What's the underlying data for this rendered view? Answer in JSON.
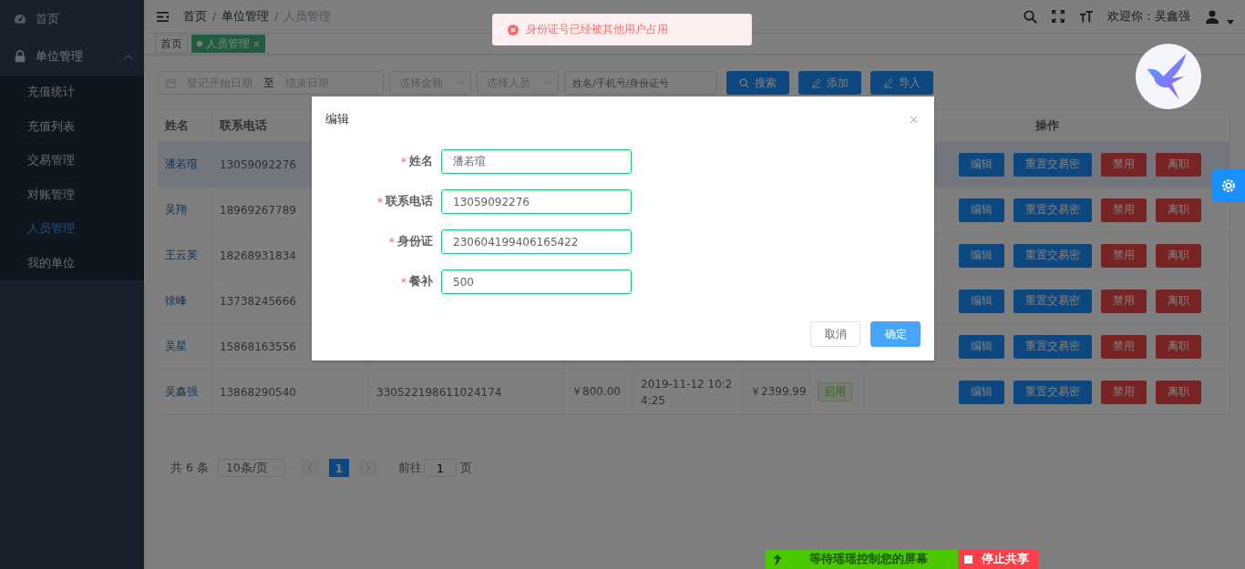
{
  "sidebar": {
    "items": [
      {
        "label": "首页",
        "kind": "dashboard"
      },
      {
        "label": "单位管理",
        "kind": "lock",
        "expanded": true,
        "children": [
          {
            "label": "充值统计",
            "selected": false
          },
          {
            "label": "充值列表",
            "selected": false
          },
          {
            "label": "交易管理",
            "selected": false
          },
          {
            "label": "对账管理",
            "selected": false
          },
          {
            "label": "人员管理",
            "selected": true
          },
          {
            "label": "我的单位",
            "selected": false
          }
        ]
      }
    ]
  },
  "header": {
    "breadcrumb": [
      "首页",
      "单位管理",
      "人员管理"
    ],
    "breadcrumb_separators": [
      "/",
      "/"
    ],
    "welcome": "欢迎你：吴鑫强"
  },
  "tags": [
    {
      "label": "首页",
      "selected": false
    },
    {
      "label": "人员管理",
      "selected": true
    }
  ],
  "filters": {
    "date_start": "登记开始日期",
    "separator": "至",
    "date_end": "结束日期",
    "amount": "选择金额",
    "status": "选择人员",
    "search": {
      "placeholder": "姓名/手机号/身份证号"
    },
    "buttons": [
      {
        "label": "搜索",
        "kind": "search"
      },
      {
        "label": "添加",
        "kind": "edit"
      },
      {
        "label": "导入",
        "kind": "edit"
      }
    ]
  },
  "table": {
    "columns": [
      "姓名",
      "联系电话",
      "操作"
    ],
    "rows": [
      {
        "name": "潘若瑄",
        "phone": "13059092276",
        "selected": true,
        "actions": [
          {
            "label": "编辑",
            "kind": "primary"
          },
          {
            "label": "重置交易密",
            "kind": "primary"
          },
          {
            "label": "禁用",
            "kind": "danger"
          },
          {
            "label": "离职",
            "kind": "danger"
          }
        ]
      },
      {
        "name": "吴翔",
        "phone": "18969267789",
        "selected": false,
        "actions": [
          {
            "label": "编辑",
            "kind": "primary"
          },
          {
            "label": "重置交易密",
            "kind": "primary"
          },
          {
            "label": "禁用",
            "kind": "danger"
          },
          {
            "label": "离职",
            "kind": "danger"
          }
        ]
      },
      {
        "name": "王云英",
        "phone": "18268931834",
        "selected": false,
        "actions": [
          {
            "label": "编辑",
            "kind": "primary"
          },
          {
            "label": "重置交易密",
            "kind": "primary"
          },
          {
            "label": "禁用",
            "kind": "danger"
          },
          {
            "label": "离职",
            "kind": "danger"
          }
        ]
      },
      {
        "name": "徐峰",
        "phone": "13738245666",
        "selected": false,
        "actions": [
          {
            "label": "编辑",
            "kind": "primary"
          },
          {
            "label": "重置交易密",
            "kind": "primary"
          },
          {
            "label": "禁用",
            "kind": "danger"
          },
          {
            "label": "离职",
            "kind": "danger"
          }
        ]
      },
      {
        "name": "吴星",
        "phone": "15868163556",
        "selected": false,
        "actions": [
          {
            "label": "编辑",
            "kind": "primary"
          },
          {
            "label": "重置交易密",
            "kind": "primary"
          },
          {
            "label": "禁用",
            "kind": "danger"
          },
          {
            "label": "离职",
            "kind": "danger"
          }
        ]
      },
      {
        "name": "吴鑫强",
        "phone": "13868290540",
        "id_card": "330522198611024174",
        "meal": "￥800.00",
        "time": "2019-11-12 10:24:25",
        "balance": "￥2399.99",
        "status": "启用",
        "selected": false,
        "actions": [
          {
            "label": "编辑",
            "kind": "primary"
          },
          {
            "label": "重置交易密",
            "kind": "primary"
          },
          {
            "label": "禁用",
            "kind": "danger"
          },
          {
            "label": "离职",
            "kind": "danger"
          }
        ]
      }
    ]
  },
  "pagination": {
    "total": "共 6 条",
    "page_size": "10条/页",
    "pages": [
      {
        "label": "1",
        "selected": true
      }
    ],
    "goto_label": "前往",
    "goto_value": "1",
    "goto_suffix": "页"
  },
  "dialog": {
    "title": "编辑",
    "required_mark": "*",
    "fields": [
      {
        "label": "姓名",
        "value": "潘若瑄",
        "required": true
      },
      {
        "label": "联系电话",
        "value": "13059092276",
        "required": true
      },
      {
        "label": "身份证",
        "value": "230604199406165422",
        "required": true
      },
      {
        "label": "餐补",
        "value": "500",
        "required": true
      }
    ],
    "buttons": [
      {
        "label": "取消",
        "kind": "default"
      },
      {
        "label": "确定",
        "kind": "primary"
      }
    ]
  },
  "toast": {
    "message": "身份证号已经被其他用户占用",
    "kind": "error"
  },
  "share_bar": {
    "status": "等待瑶瑶控制您的屏幕",
    "stop": "停止共享"
  }
}
